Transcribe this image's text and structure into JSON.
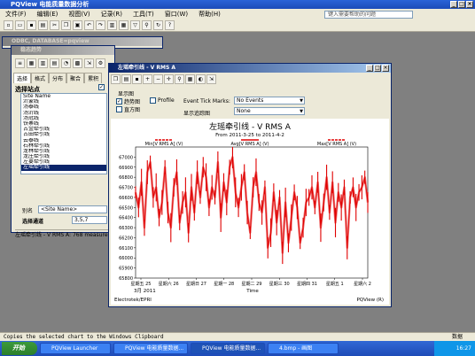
{
  "app": {
    "title": "PQView 电能质量数据分析",
    "menu": [
      "文件(F)",
      "编辑(E)",
      "视图(V)",
      "记录(R)",
      "工具(T)",
      "窗口(W)",
      "帮助(H)"
    ],
    "help_search_placeholder": "键入需要帮助的问题"
  },
  "odbc_window": {
    "title": "ODBC, DATABASE=pqview"
  },
  "trend_window": {
    "title": "稳态趋势",
    "tabs": [
      "选择",
      "格式",
      "分布",
      "聚合",
      "累积"
    ],
    "select_site_label": "选择站点",
    "site_list": [
      "Site Name",
      "沂蒙线",
      "汤泰线",
      "汤沂线",
      "汤冠线",
      "铁寨线",
      "古金牵引线",
      "古田牵引线",
      "云泰线",
      "石林牵引线",
      "龙林牵引线",
      "龙庄牵引线",
      "左宴牵引线",
      "左瑶牵引线"
    ],
    "selected_site": "左瑶牵引线",
    "alias_label": "别名",
    "alias_value": "<Site Name>",
    "select_channel_label": "选择通道",
    "select_channel_value": "3,5,7",
    "bottom_caption": "左瑶牵引线 - V RMS A: 768 measurem"
  },
  "chart_window": {
    "title": "左瑶牵引线 - V RMS A",
    "display_group_label": "显示图",
    "check_trend": "趋势图",
    "check_histogram": "直方图",
    "check_profile": "Profile",
    "event_tick_label": "Event Tick Marks:",
    "event_tick_value": "No Events",
    "display_tracking_label": "显示追踪图",
    "display_tracking_value": "None"
  },
  "chart_data": {
    "type": "line",
    "title": "左瑶牵引线 - V RMS A",
    "subtitle": "From 2011-3-25 to 2011-4-2",
    "legend": [
      "Min[V RMS A] (V)",
      "Avg[V RMS A] (V)",
      "Max[V RMS A] (V)"
    ],
    "ylim": [
      65800,
      67100
    ],
    "yticks": [
      65800,
      65900,
      66000,
      66100,
      66200,
      66300,
      66400,
      66500,
      66600,
      66700,
      66800,
      66900,
      67000
    ],
    "xticks": [
      "星期五 25",
      "星期六 26",
      "星期日 27",
      "星期一 28",
      "星期二 29",
      "星期三 30",
      "星期四 31",
      "星期五 1",
      "星期六 2"
    ],
    "x_sub_label": "3月 2011",
    "xlabel": "Time",
    "footer_left": "Electrotek/EPRI",
    "footer_right": "PQView (R)",
    "series_color": "#e00000",
    "series": [
      {
        "name": "Avg[V RMS A] (V)",
        "values": [
          66650,
          66500,
          66750,
          66300,
          66850,
          66950,
          66600,
          66700,
          66400,
          66550,
          66900,
          66450,
          66300,
          66700,
          66850,
          66350,
          66550,
          66650,
          66250,
          66700,
          66450,
          66850,
          66600,
          66900,
          66800,
          66500,
          66700,
          66600,
          66950,
          66400,
          66750,
          66550,
          66900,
          67000,
          66650,
          66500,
          66700,
          66850,
          66450,
          66250,
          66700,
          66850,
          66550,
          66450,
          66700,
          66100,
          66250,
          66650,
          66350,
          66600,
          66050,
          66550,
          66150,
          66400,
          66650,
          66500,
          66150,
          66300,
          66550,
          66600,
          66700,
          66500,
          66750,
          66300,
          66550,
          66800,
          66450,
          66750,
          66350,
          66650,
          66500,
          66700,
          66100,
          66600,
          66700,
          66500,
          66650,
          66700,
          66800,
          66550
        ]
      }
    ]
  },
  "status_bar": {
    "text": "Copies the selected chart to the Windows Clipboard",
    "right": "数据"
  },
  "taskbar": {
    "start": "开始",
    "tasks": [
      "PQView Launcher",
      "PQView 电能质量数据...",
      "PQView 电能质量数据...",
      "4.bmp - 画图"
    ],
    "clock": "16:27"
  }
}
